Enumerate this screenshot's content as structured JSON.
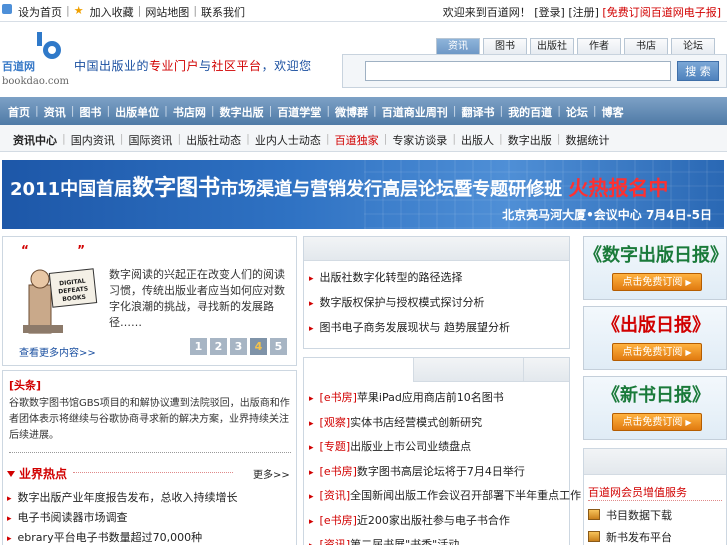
{
  "topbar": {
    "links": [
      "设为首页",
      "加入收藏",
      "网站地图",
      "联系我们"
    ],
    "right_text": "欢迎来到百道网！",
    "login": "[登录]",
    "register": "[注册]",
    "promo": "[免费订阅百道网电子报]"
  },
  "logo": {
    "cn": "百道网",
    "en": "bookdao.com"
  },
  "slogan": {
    "p1": "中国出版业的",
    "p2": "专业门户",
    "p3": "与",
    "p4": "社区平台",
    "p5": "，欢迎您"
  },
  "search": {
    "tabs": [
      "资讯",
      "图书",
      "出版社",
      "作者",
      "书店",
      "论坛"
    ],
    "active_index": 0,
    "placeholder": "",
    "button": "搜 索"
  },
  "mainnav": [
    "首页",
    "资讯",
    "图书",
    "出版单位",
    "书店网",
    "数字出版",
    "百道学堂",
    "微博群",
    "百道商业周刊",
    "翻译书",
    "我的百道",
    "论坛",
    "博客"
  ],
  "subnav": {
    "items": [
      "资讯中心",
      "国内资讯",
      "国际资讯",
      "出版社动态",
      "业内人士动态",
      "百道独家",
      "专家访谈录",
      "出版人",
      "数字出版",
      "数据统计"
    ],
    "hot_index": 5
  },
  "banner": {
    "line1_a": "2011中国首届",
    "line1_b": "数字图书",
    "line1_c": "市场渠道与营销发行高层论坛暨专题研修班",
    "line1_d": "火热报名中",
    "line2": "北京亮马河大厦•会议中心  7月4日-5日"
  },
  "feature": {
    "quote_marks": "“ ”",
    "image_text": "DIGITAL DEFEATS BOOKS",
    "text": "数字阅读的兴起正在改变人们的阅读习惯，传统出版业者应当如何应对数字化浪潮的挑战，寻找新的发展路径……",
    "more": "查看更多内容>>",
    "pages": [
      "1",
      "2",
      "3",
      "4",
      "5"
    ],
    "active_page": 3
  },
  "news": {
    "tag": "[头条]",
    "para": "谷歌数字图书馆GBS项目的和解协议遭到法院驳回，出版商和作者团体表示将继续与谷歌协商寻求新的解决方案，业界持续关注后续进展。",
    "section_title": "业界热点",
    "section_more": "更多>>",
    "items": [
      "数字出版产业年度报告发布，总收入持续增长",
      "电子书阅读器市场调查",
      "ebrary平台电子书数量超过70,000种"
    ]
  },
  "mid_top": {
    "items": [
      "出版社数字化转型的路径选择",
      "数字版权保护与授权模式探讨分析",
      "图书电子商务发展现状与 趋势展望分析"
    ]
  },
  "mid_lower": {
    "items": [
      {
        "cat": "[e书房]",
        "text": "苹果iPad应用商店前10名图书"
      },
      {
        "cat": "[观察]",
        "text": "实体书店经营模式创新研究"
      },
      {
        "cat": "[专题]",
        "text": "出版业上市公司业绩盘点"
      },
      {
        "cat": "[e书房]",
        "text": "数字图书高层论坛将于7月4日举行"
      },
      {
        "cat": "[资讯]",
        "text": "全国新闻出版工作会议召开部署下半年重点工作"
      },
      {
        "cat": "[e书房]",
        "text": "近200家出版社参与电子书合作"
      },
      {
        "cat": "[资讯]",
        "text": "第二届书展\"书香\"活动"
      }
    ]
  },
  "right_ads": [
    {
      "title": "《数字出版日报》",
      "color": "#1a7a3a",
      "button": "点击免费订阅"
    },
    {
      "title": "《出版日报》",
      "color": "#d10000",
      "button": "点击免费订阅"
    },
    {
      "title": "《新书日报》",
      "color": "#1a7a3a",
      "button": "点击免费订阅"
    }
  ],
  "right_lower": {
    "sub": "百道网会员增值服务",
    "items": [
      "书目数据下载",
      "新书发布平台"
    ]
  }
}
